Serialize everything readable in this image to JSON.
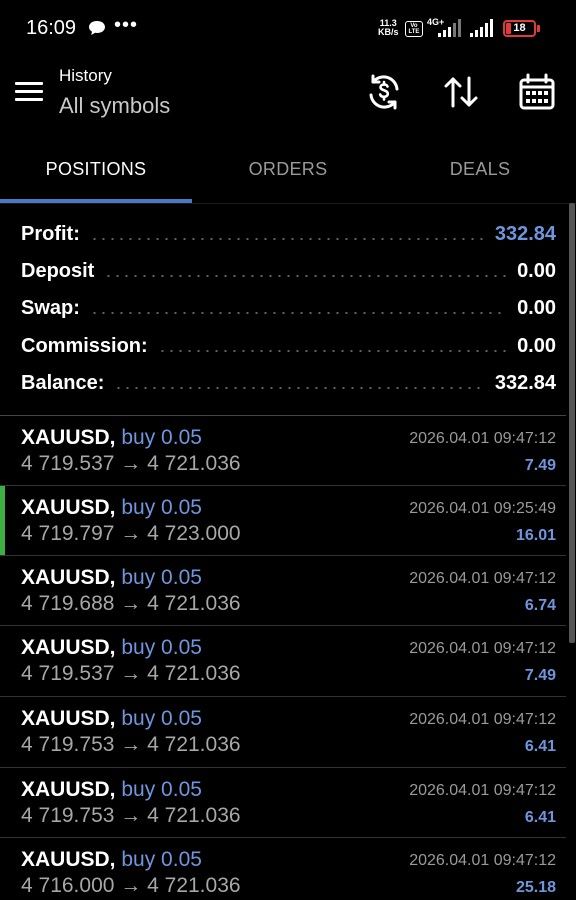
{
  "status_bar": {
    "time": "16:09",
    "speed_value": "11.3",
    "speed_unit": "KB/s",
    "volte_top": "Vo",
    "volte_bottom": "LTE",
    "network": "4G+",
    "battery": "18",
    "battery_color": "#e03a3a"
  },
  "header": {
    "title": "History",
    "subtitle": "All symbols",
    "icons": [
      "currency-exchange-icon",
      "sort-icon",
      "calendar-icon"
    ]
  },
  "tabs": [
    {
      "label": "POSITIONS",
      "active": true
    },
    {
      "label": "ORDERS",
      "active": false
    },
    {
      "label": "DEALS",
      "active": false
    }
  ],
  "summary": [
    {
      "label": "Profit:",
      "value": "332.84",
      "highlight": true
    },
    {
      "label": "Deposit",
      "value": "0.00",
      "highlight": false
    },
    {
      "label": "Swap:",
      "value": "0.00",
      "highlight": false
    },
    {
      "label": "Commission:",
      "value": "0.00",
      "highlight": false
    },
    {
      "label": "Balance:",
      "value": "332.84",
      "highlight": false
    }
  ],
  "positions": [
    {
      "symbol": "XAUUSD,",
      "type": "buy 0.05",
      "open_price": "4 719.537",
      "close_price": "4 721.036",
      "arrow": "→",
      "datetime": "2026.04.01 09:47:12",
      "profit": "7.49",
      "selected": false
    },
    {
      "symbol": "XAUUSD,",
      "type": "buy 0.05",
      "open_price": "4 719.797",
      "close_price": "4 723.000",
      "arrow": "→",
      "datetime": "2026.04.01 09:25:49",
      "profit": "16.01",
      "selected": true
    },
    {
      "symbol": "XAUUSD,",
      "type": "buy 0.05",
      "open_price": "4 719.688",
      "close_price": "4 721.036",
      "arrow": "→",
      "datetime": "2026.04.01 09:47:12",
      "profit": "6.74",
      "selected": false
    },
    {
      "symbol": "XAUUSD,",
      "type": "buy 0.05",
      "open_price": "4 719.537",
      "close_price": "4 721.036",
      "arrow": "→",
      "datetime": "2026.04.01 09:47:12",
      "profit": "7.49",
      "selected": false
    },
    {
      "symbol": "XAUUSD,",
      "type": "buy 0.05",
      "open_price": "4 719.753",
      "close_price": "4 721.036",
      "arrow": "→",
      "datetime": "2026.04.01 09:47:12",
      "profit": "6.41",
      "selected": false
    },
    {
      "symbol": "XAUUSD,",
      "type": "buy 0.05",
      "open_price": "4 719.753",
      "close_price": "4 721.036",
      "arrow": "→",
      "datetime": "2026.04.01 09:47:12",
      "profit": "6.41",
      "selected": false
    },
    {
      "symbol": "XAUUSD,",
      "type": "buy 0.05",
      "open_price": "4 716.000",
      "close_price": "4 721.036",
      "arrow": "→",
      "datetime": "2026.04.01 09:47:12",
      "profit": "25.18",
      "selected": false
    }
  ],
  "colors": {
    "accent": "#6f96dd",
    "tab_indicator": "#4a78c9",
    "selected_bar": "#3cb043"
  }
}
